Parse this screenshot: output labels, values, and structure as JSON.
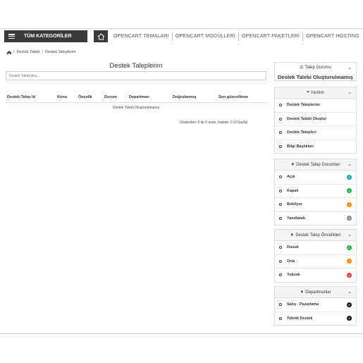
{
  "header": {
    "category_label": "TÜM KATEGORİLER",
    "nav": [
      "OPENCART TEMALARI",
      "OPENCART MODÜLLERİ",
      "OPENCART PAKETLERİ",
      "OPENCART HOSTİNG"
    ]
  },
  "breadcrumb": [
    "Destek Talebi",
    "Destek Taleplerim"
  ],
  "main": {
    "title": "Destek Taleplerim",
    "search_placeholder": "Destek Talebi Ara...",
    "columns": [
      "Destek Talep Id",
      "Konu",
      "Öncelik",
      "Durum",
      "Departman",
      "Doğrulanmış",
      "Son güncelleme"
    ],
    "empty_text": "Destek Talebi Oluşturulmamış",
    "pagination": "Gösterilen: 0 ile 0 arası, toplam: 0 (0 Sayfa)"
  },
  "sidebar": {
    "status_box": {
      "title": "Talep Durumu",
      "value": "Destek Talebi Oluşturulmamış"
    },
    "help": {
      "title": "Yardım",
      "items": [
        "Destek Taleplerim",
        "Destek Talebi Oluştur",
        "Destek Talepleri",
        "Bilgi Başlıkları"
      ]
    },
    "statuses": {
      "title": "Destek Talep Durumları",
      "items": [
        {
          "label": "Açık",
          "count": "0",
          "color": "#17a2b8"
        },
        {
          "label": "Kapalı",
          "count": "0",
          "color": "#28a745"
        },
        {
          "label": "Bekliyor",
          "count": "0",
          "color": "#f08c00"
        },
        {
          "label": "Yanıtlandı",
          "count": "0",
          "color": "#888888"
        }
      ]
    },
    "priorities": {
      "title": "Destek Talep Öncelikleri",
      "items": [
        {
          "label": "Dusuk",
          "count": "0",
          "color": "#28a745"
        },
        {
          "label": "Orta",
          "count": "0",
          "color": "#f08c00"
        },
        {
          "label": "Yuksek",
          "count": "0",
          "color": "#dc3545"
        }
      ]
    },
    "departments": {
      "title": "Departmanlar",
      "items": [
        {
          "label": "Satış - Pazarlama",
          "count": "0",
          "color": "#111111"
        },
        {
          "label": "Teknik Destek",
          "count": "0",
          "color": "#111111"
        }
      ]
    }
  }
}
